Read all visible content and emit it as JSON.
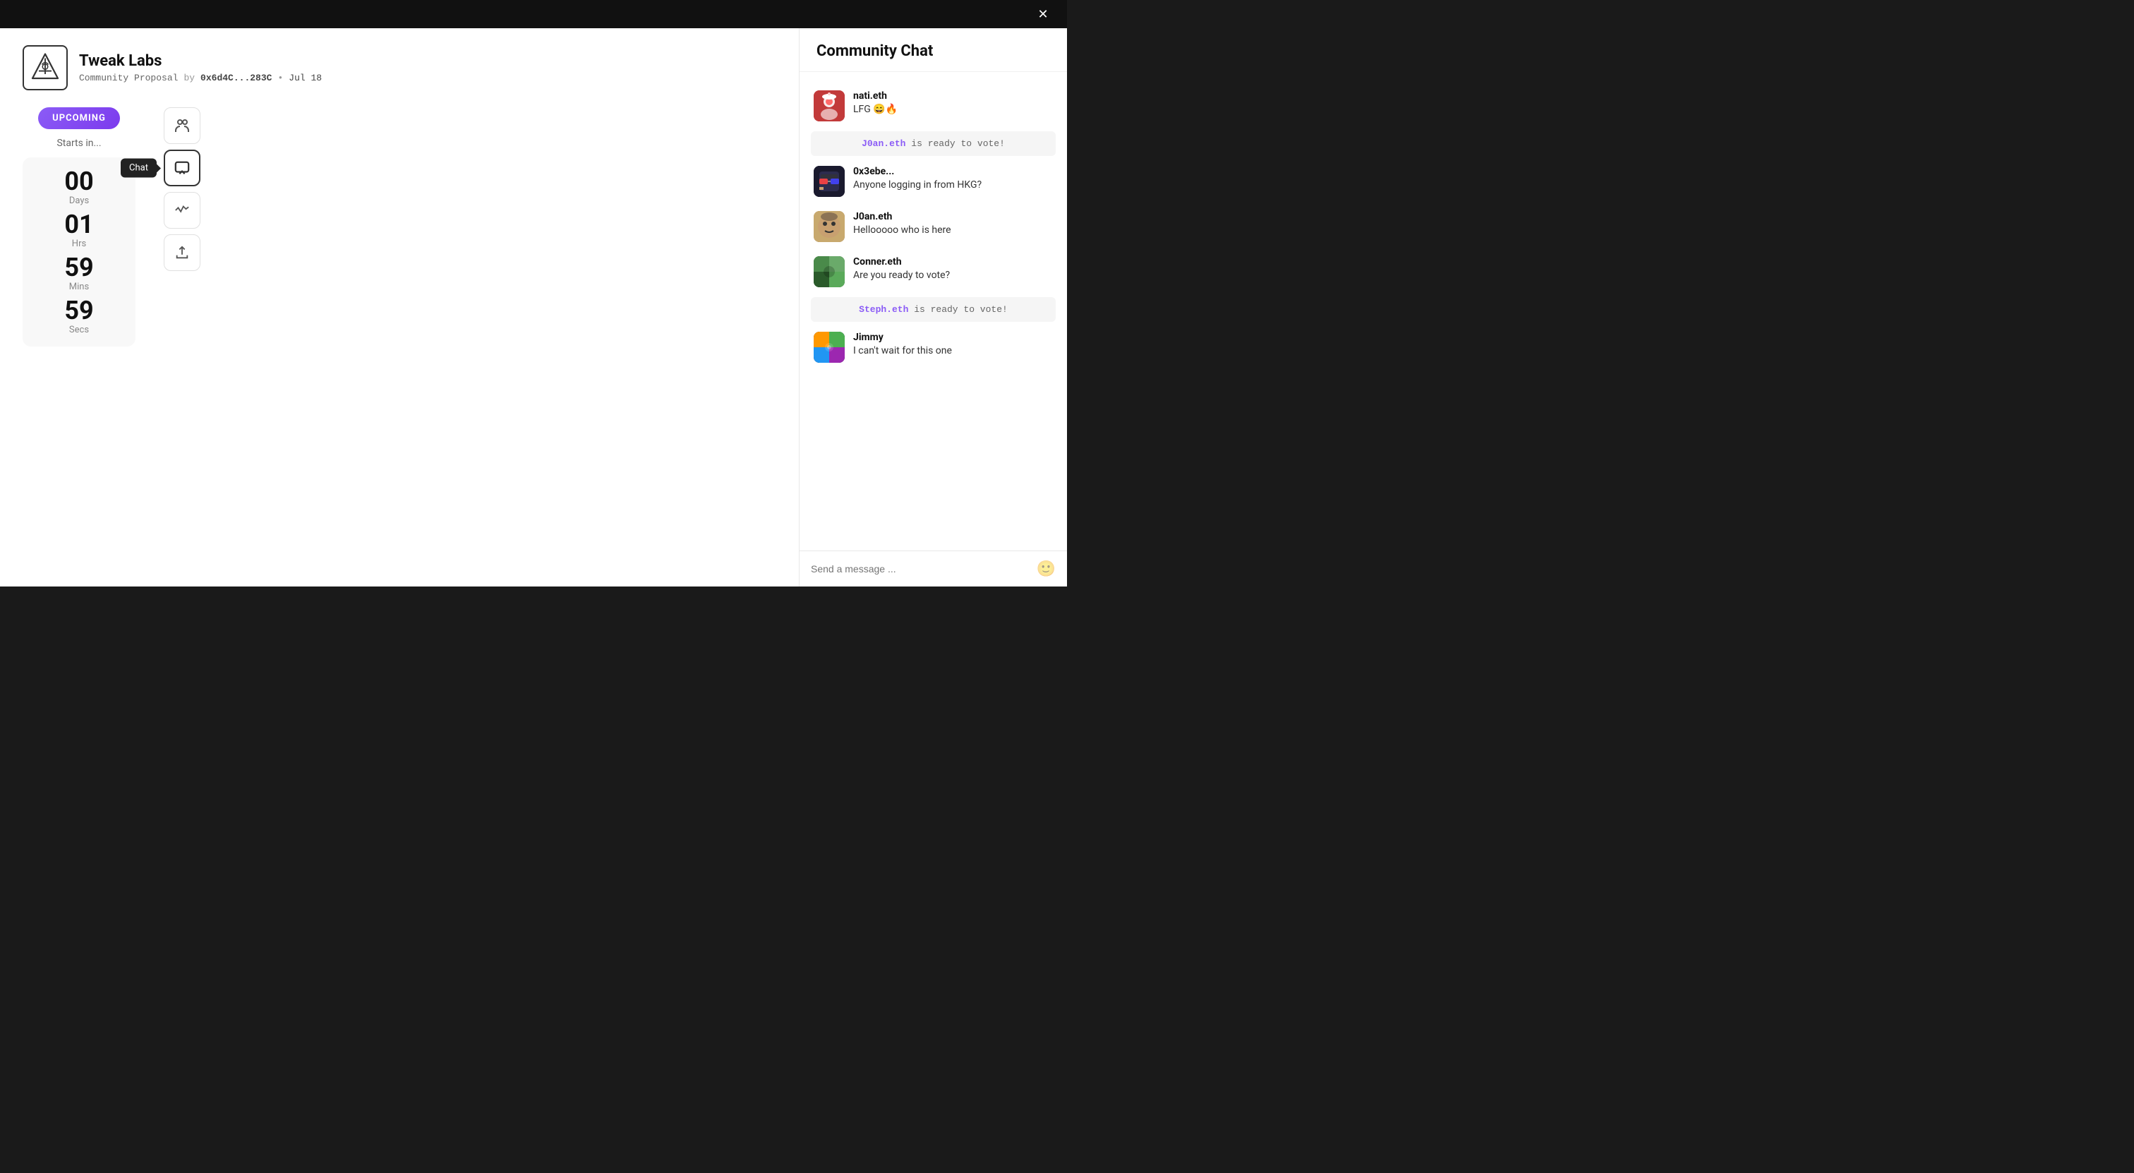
{
  "topbar": {
    "close_label": "✕"
  },
  "proposal": {
    "title": "Tweak Labs",
    "meta": {
      "type": "Community Proposal",
      "by_label": "by",
      "address": "0x6d4C...283C",
      "dot": "•",
      "date": "Jul 18"
    }
  },
  "status": {
    "badge": "UPCOMING",
    "starts_in": "Starts in..."
  },
  "countdown": {
    "days": {
      "value": "00",
      "label": "Days"
    },
    "hrs": {
      "value": "01",
      "label": "Hrs"
    },
    "mins": {
      "value": "59",
      "label": "Mins"
    },
    "secs": {
      "value": "59",
      "label": "Secs"
    }
  },
  "side_buttons": {
    "people_icon": "👥",
    "chat_icon": "💬",
    "activity_icon": "📈",
    "share_icon": "⬆"
  },
  "chat_tooltip": "Chat",
  "image_buttons": {
    "bottom_left_icon": "⬡",
    "bottom_right_icon": "⤢"
  },
  "community_chat": {
    "title": "Community Chat",
    "messages": [
      {
        "username": "nati.eth",
        "text": "LFG 😄🔥",
        "avatar_class": "avatar-1"
      },
      {
        "type": "system",
        "address": "J0an.eth",
        "text": " is ready to vote!"
      },
      {
        "username": "0x3ebe...",
        "text": "Anyone logging in from HKG?",
        "avatar_class": "avatar-2"
      },
      {
        "username": "J0an.eth",
        "text": "Hellooooo who is here",
        "avatar_class": "avatar-3"
      },
      {
        "username": "Conner.eth",
        "text": "Are you ready to vote?",
        "avatar_class": "avatar-4"
      },
      {
        "type": "system",
        "address": "Steph.eth",
        "text": " is ready to vote!"
      },
      {
        "username": "Jimmy",
        "text": "I can't wait for this one",
        "avatar_class": "avatar-5"
      }
    ],
    "input_placeholder": "Send a message ...",
    "emoji_button": "🙂"
  }
}
